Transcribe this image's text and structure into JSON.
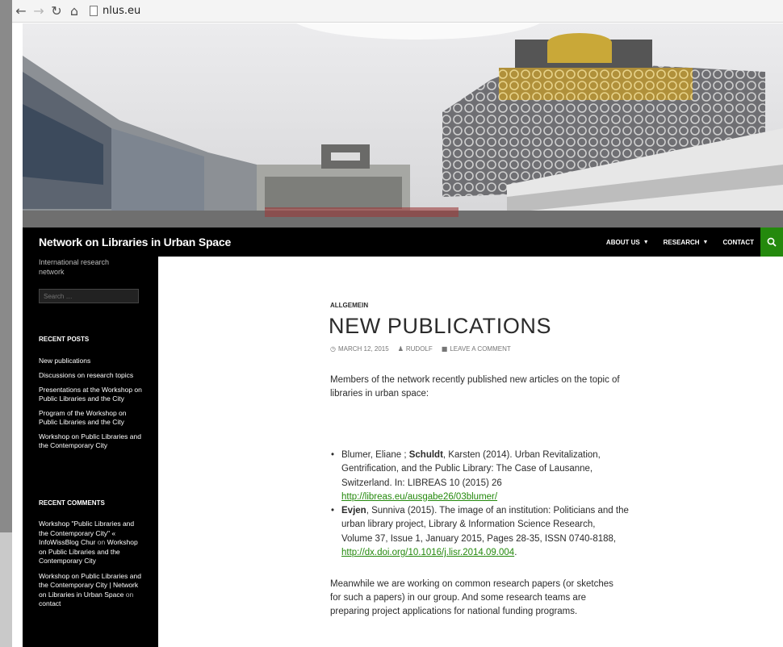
{
  "browser": {
    "back_icon": "back-arrow-icon",
    "forward_icon": "forward-arrow-icon",
    "reload_icon": "reload-icon",
    "home_icon": "home-icon",
    "url": "nlus.eu"
  },
  "site": {
    "title": "Network on Libraries in Urban Space",
    "tagline": "International research network"
  },
  "nav": {
    "items": [
      {
        "label": "ABOUT US",
        "has_dropdown": true
      },
      {
        "label": "RESEARCH",
        "has_dropdown": true
      },
      {
        "label": "CONTACT",
        "has_dropdown": false
      }
    ],
    "search_icon": "search-icon",
    "accent_color": "#24890d"
  },
  "sidebar": {
    "search_placeholder": "Search …",
    "recent_posts_title": "RECENT POSTS",
    "recent_posts": [
      "New publications",
      "Discussions on research topics",
      "Presentations at the Workshop on Public Libraries and the City",
      "Program of the Workshop on Public Libraries and the City",
      "Workshop on Public Libraries and the Contemporary City"
    ],
    "recent_comments_title": "RECENT COMMENTS",
    "recent_comments": [
      {
        "author": "Workshop \"Public Libraries and the Contemporary City\" « InfoWissBlog Chur",
        "on": "on",
        "post": "Workshop on Public Libraries and the Contemporary City"
      },
      {
        "author": "Workshop on Public Libraries and the Contemporary City | Network on Libraries in Urban Space",
        "on": "on",
        "post": "contact"
      }
    ]
  },
  "article": {
    "category": "ALLGEMEIN",
    "title": "NEW PUBLICATIONS",
    "date": "MARCH 12, 2015",
    "author": "RUDOLF",
    "comment_link": "LEAVE A COMMENT",
    "intro": "Members of the network recently published new articles on the topic of libraries in urban space:",
    "references": [
      {
        "pre": "Blumer, Eliane ; ",
        "bold": "Schuldt",
        "post": ", Karsten (2014). Urban Revitalization, Gentrification, and the Public Library: The Case of Lausanne, Switzerland. In: LIBREAS 10 (2015) 26 ",
        "link": "http://libreas.eu/ausgabe26/03blumer/",
        "tail": ""
      },
      {
        "pre": "",
        "bold": "Evjen",
        "post": ", Sunniva (2015). The image of an institution: Politicians and the urban library project, Library & Information Science Research, Volume 37, Issue 1, January 2015, Pages 28-35, ISSN 0740-8188, ",
        "link": "http://dx.doi.org/10.1016/j.lisr.2014.09.004",
        "tail": "."
      }
    ],
    "closing": "Meanwhile we are working on common research papers (or sketches for such a papers) in our group. And some research teams are preparing project applications for national funding programs."
  }
}
